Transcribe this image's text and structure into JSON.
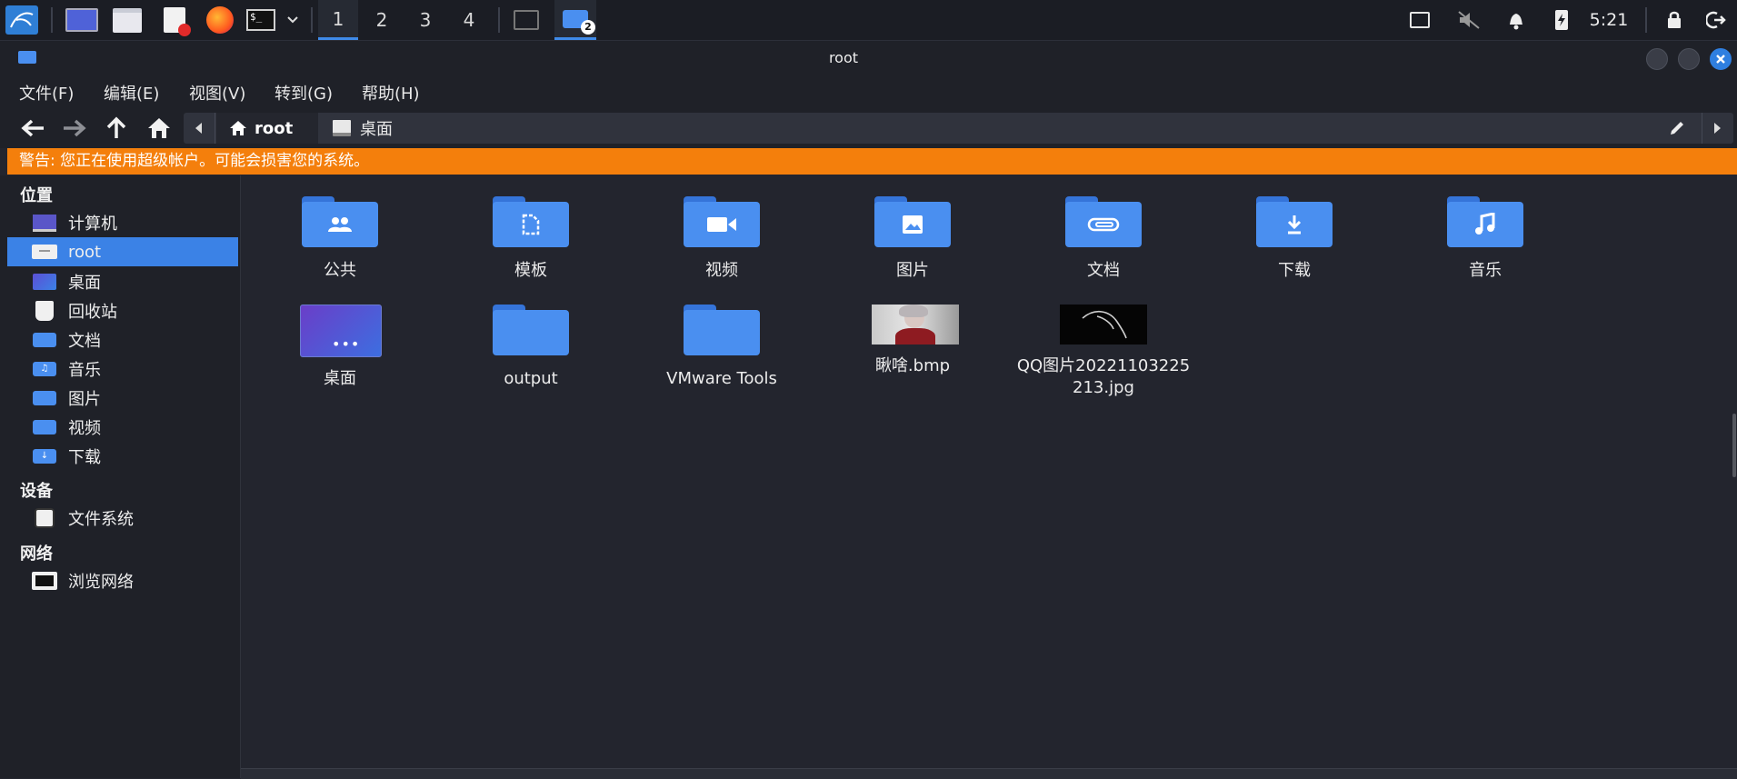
{
  "taskbar": {
    "workspaces": [
      "1",
      "2",
      "3",
      "4"
    ],
    "active_workspace": "1",
    "file_manager_badge": "2",
    "clock": "5:21"
  },
  "window": {
    "title": "root"
  },
  "menubar": {
    "items": [
      "文件(F)",
      "编辑(E)",
      "视图(V)",
      "转到(G)",
      "帮助(H)"
    ]
  },
  "pathbar": {
    "crumbs": [
      "root",
      "桌面"
    ]
  },
  "warning": "警告: 您正在使用超级帐户。可能会损害您的系统。",
  "sidebar": {
    "places_title": "位置",
    "places": [
      {
        "label": "计算机",
        "icon": "computer-icon"
      },
      {
        "label": "root",
        "icon": "home-folder-icon"
      },
      {
        "label": "桌面",
        "icon": "desktop-icon"
      },
      {
        "label": "回收站",
        "icon": "trash-icon"
      },
      {
        "label": "文档",
        "icon": "documents-icon"
      },
      {
        "label": "音乐",
        "icon": "music-icon"
      },
      {
        "label": "图片",
        "icon": "pictures-icon"
      },
      {
        "label": "视频",
        "icon": "videos-icon"
      },
      {
        "label": "下载",
        "icon": "downloads-icon"
      }
    ],
    "selected": "root",
    "devices_title": "设备",
    "devices": [
      {
        "label": "文件系统",
        "icon": "drive-icon"
      }
    ],
    "network_title": "网络",
    "network": [
      {
        "label": "浏览网络",
        "icon": "network-icon"
      }
    ]
  },
  "files": [
    {
      "name": "公共",
      "icon": "public-folder-icon"
    },
    {
      "name": "模板",
      "icon": "templates-folder-icon"
    },
    {
      "name": "视频",
      "icon": "videos-folder-icon"
    },
    {
      "name": "图片",
      "icon": "pictures-folder-icon"
    },
    {
      "name": "文档",
      "icon": "documents-folder-icon"
    },
    {
      "name": "下载",
      "icon": "downloads-folder-icon"
    },
    {
      "name": "音乐",
      "icon": "music-folder-icon"
    },
    {
      "name": "桌面",
      "icon": "desktop-folder-icon"
    },
    {
      "name": "output",
      "icon": "folder-icon"
    },
    {
      "name": "VMware Tools",
      "icon": "folder-icon"
    },
    {
      "name": "瞅啥.bmp",
      "icon": "image-thumbnail-icon"
    },
    {
      "name": "QQ图片20221103225213.jpg",
      "icon": "image-thumbnail-icon"
    }
  ],
  "colors": {
    "accent": "#3b82e6",
    "warning_bg": "#f47f0c",
    "folder": "#4a8ff0",
    "background": "#23252e"
  }
}
